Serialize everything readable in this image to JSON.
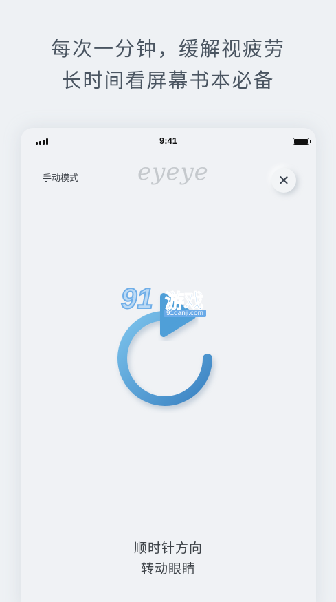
{
  "headline": {
    "line1": "每次一分钟，缓解视疲劳",
    "line2": "长时间看屏幕书本必备"
  },
  "status_bar": {
    "time": "9:41",
    "signal_icon": "cellular-signal-icon",
    "battery_icon": "battery-icon"
  },
  "header": {
    "mode_label": "手动模式",
    "logo_text": "eyeye",
    "close_label": "✕"
  },
  "exercise": {
    "icon": "clockwise-rotate-icon",
    "instruction_line1": "顺时针方向",
    "instruction_line2": "转动眼睛"
  },
  "watermark": {
    "number": "91",
    "text": "游戏",
    "domain": "91danji.com"
  },
  "colors": {
    "background": "#eef1f4",
    "headline": "#4a5561",
    "arrow_light": "#6bb7e8",
    "arrow_dark": "#3d87c4"
  }
}
